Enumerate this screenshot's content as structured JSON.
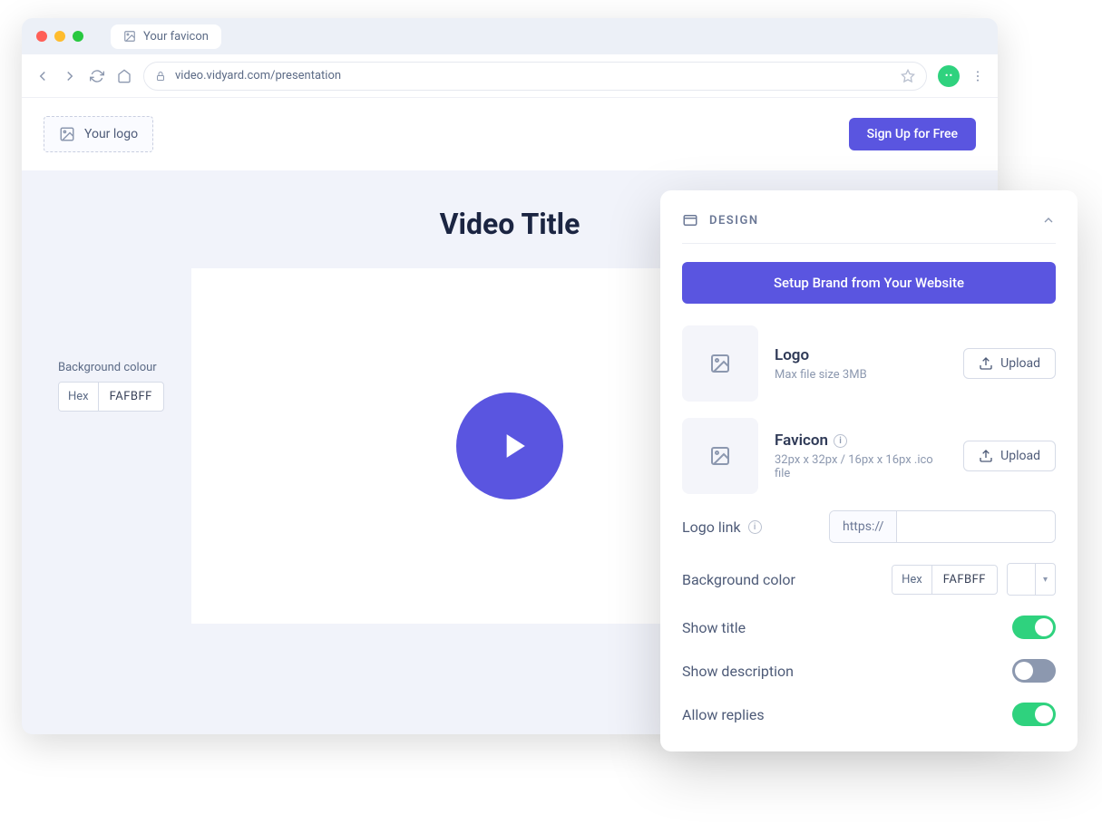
{
  "browser": {
    "tab_title": "Your favicon",
    "url": "video.vidyard.com/presentation"
  },
  "header": {
    "logo_placeholder": "Your logo",
    "signup_label": "Sign Up for Free"
  },
  "main": {
    "video_title": "Video Title",
    "bg_colour_label": "Background colour",
    "hex_label": "Hex",
    "hex_value": "FAFBFF"
  },
  "panel": {
    "title": "DESIGN",
    "brand_button": "Setup Brand from Your Website",
    "logo": {
      "title": "Logo",
      "sub": "Max file size 3MB",
      "upload": "Upload"
    },
    "favicon": {
      "title": "Favicon",
      "sub": "32px x 32px / 16px x 16px .ico file",
      "upload": "Upload"
    },
    "logo_link": {
      "label": "Logo link",
      "prefix": "https://",
      "value": ""
    },
    "bg_color": {
      "label": "Background color",
      "hex_label": "Hex",
      "hex_value": "FAFBFF"
    },
    "show_title": {
      "label": "Show title",
      "value": true
    },
    "show_description": {
      "label": "Show description",
      "value": false
    },
    "allow_replies": {
      "label": "Allow replies",
      "value": true
    }
  }
}
